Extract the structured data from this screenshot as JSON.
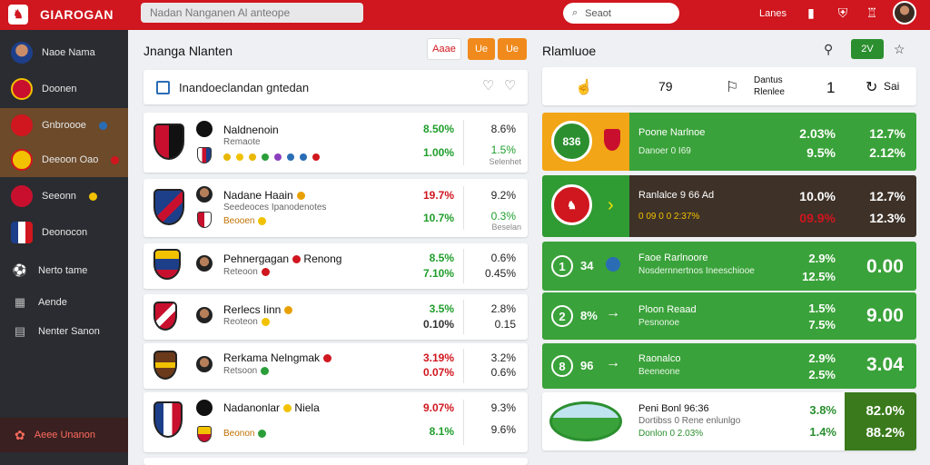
{
  "app": {
    "title": "GIAROGAN",
    "logo_glyph": "♞"
  },
  "header": {
    "top_search_text": "Nadan Nanganen Al anteope",
    "search_placeholder": "Seaot",
    "status_text": "Lanes",
    "icons": [
      "bookmark-icon",
      "shield-icon",
      "trophy-icon",
      "avatar"
    ],
    "accent_color": "#d0161e"
  },
  "sidebar": {
    "items": [
      {
        "label": "Naoe Nama",
        "icon": "player-icon"
      },
      {
        "label": "Doonen",
        "icon": "club-crest-icon"
      },
      {
        "label": "Gnbroooe",
        "icon": "club-crest-icon",
        "active": true,
        "badge_color": "#2a6db5"
      },
      {
        "label": "Deeoon Oao",
        "icon": "club-crest-icon",
        "active": true,
        "badge_color": "#d0161e"
      },
      {
        "label": "Seeonn",
        "icon": "club-crest-icon",
        "badge_color": "#f2c200"
      },
      {
        "label": "Deonocon",
        "icon": "club-crest-icon"
      },
      {
        "label": "Nerto tame",
        "icon": "ball-icon"
      },
      {
        "label": "Aende",
        "icon": "calendar-icon"
      },
      {
        "label": "Nenter Sanon",
        "icon": "grid-icon"
      }
    ],
    "bottom_label": "Aeee Unanon"
  },
  "middle": {
    "title": "Jnanga Nlanten",
    "buttons": [
      "Aaae",
      "Ue",
      "Ue"
    ],
    "filter_label": "Inandoeclandan gntedan",
    "matches": [
      {
        "name": "Naldnenoin",
        "sub": "Remaote",
        "pct_a": "8.50%",
        "pct_a_color": "green",
        "pct_a2": "1.00%",
        "pct_b": "8.6%",
        "pct_b2": "1.5%",
        "note": "Selenhet"
      },
      {
        "name": "Nadane Haain",
        "sub": "Seedeoces Ipanodenotes",
        "sub2": "Beooen",
        "pct_a": "19.7%",
        "pct_a_color": "red",
        "pct_a2": "10.7%",
        "pct_b": "9.2%",
        "pct_b2": "0.3%",
        "note": "Beselan"
      },
      {
        "name": "Pehnergagan",
        "name2": "Renong",
        "sub": "Reteoon",
        "pct_a": "8.5%",
        "pct_a_color": "green",
        "pct_a2": "7.10%",
        "pct_b": "0.6%",
        "pct_b2": "0.45%"
      },
      {
        "name": "Rerlecs Iinn",
        "sub": "Reoteon",
        "pct_a": "3.5%",
        "pct_a_color": "green",
        "pct_a2": "0.10%",
        "pct_b": "2.8%",
        "pct_b2": "0.15"
      },
      {
        "name": "Rerkama Nelngmak",
        "sub": "Retsoon",
        "pct_a": "3.19%",
        "pct_a_color": "red",
        "pct_a2": "0.07%",
        "pct_b": "3.2%",
        "pct_b2": "0.6%"
      },
      {
        "name": "Nadanonlar",
        "name2": "Niela",
        "sub": "Beonon",
        "pct_a": "9.07%",
        "pct_a_color": "red",
        "pct_a2": "8.1%",
        "pct_b": "9.3%",
        "pct_b2": "9.6%"
      }
    ]
  },
  "right": {
    "title": "Rlamluoe",
    "green_button": "2V",
    "summary": {
      "val1": "79",
      "label": "Dantus",
      "label2": "Rlenlee",
      "val2": "1",
      "val3": "Sai"
    },
    "cards": [
      {
        "badge": "836",
        "name": "Poone Narlnoe",
        "sub": "Danoer 0 I69",
        "pct1": "2.03%",
        "pct2": "9.5%",
        "pct3": "12.7%",
        "pct4": "2.12%"
      },
      {
        "badge": "",
        "name": "Ranlalce 9 66 Ad",
        "sub": "0 09 0 0 2:37%",
        "pct1": "10.0%",
        "pct2": "09.9%",
        "pct3": "12.7%",
        "pct4": "12.3%"
      },
      {
        "num": "1",
        "label": "34",
        "name": "Faoe Rarlnoore",
        "sub": "Nosdernnertnos Ineeschiooe",
        "pct1": "2.9%",
        "pct2": "12.5%",
        "big": "0.00"
      },
      {
        "num": "2",
        "label": "8%",
        "name": "Ploon Reaad",
        "sub": "Pesnonoe",
        "pct1": "1.5%",
        "pct2": "7.5%",
        "big": "9.00"
      },
      {
        "num": "8",
        "label": "96",
        "name": "Raonalco",
        "sub": "Beeneone",
        "pct1": "2.9%",
        "pct2": "2.5%",
        "big": "3.04"
      },
      {
        "name": "Peni Bonl 96:36",
        "sub": "Dortibss 0 Rene enlunlgo",
        "sub2": "Donlon 0 2.03%",
        "pct1": "3.8%",
        "pct2": "1.4%",
        "pct3": "82.0%",
        "pct4": "88.2%"
      }
    ]
  }
}
